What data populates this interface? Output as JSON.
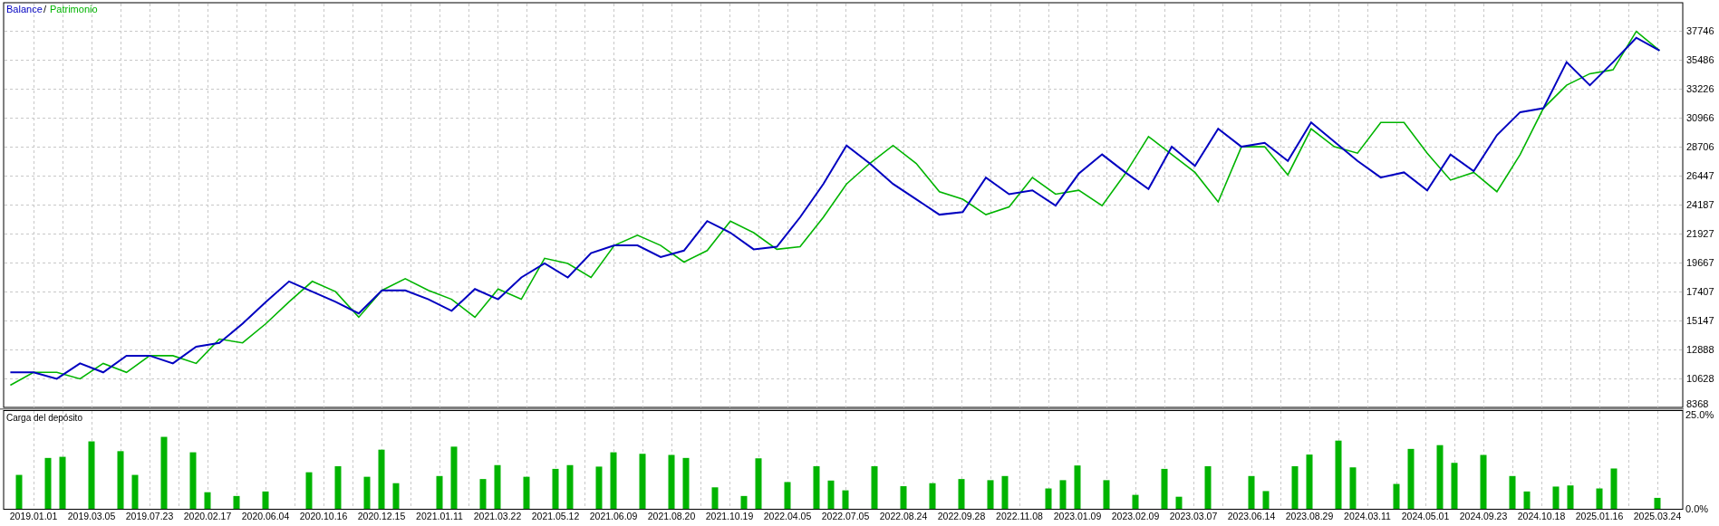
{
  "equity_chart": {
    "legend_separator": "/",
    "chart_data": {
      "type": "line",
      "grid": true,
      "ylim": [
        8368,
        39935
      ],
      "yticks": [
        8368,
        10628,
        12888,
        15147,
        17407,
        19667,
        21927,
        24187,
        26447,
        28706,
        30966,
        33226,
        35486,
        37746
      ],
      "series": [
        {
          "name": "Balance",
          "color": "#0000c0",
          "values": [
            11100,
            11100,
            10600,
            11800,
            11100,
            12400,
            12400,
            11800,
            13100,
            13400,
            14900,
            16600,
            18200,
            17400,
            16600,
            15700,
            17500,
            17500,
            16800,
            15900,
            17600,
            16800,
            18500,
            19600,
            18500,
            20400,
            21000,
            21000,
            20100,
            20600,
            22900,
            22000,
            20700,
            20900,
            23200,
            25800,
            28800,
            27400,
            25800,
            24600,
            23400,
            23600,
            26300,
            25000,
            25300,
            24100,
            26600,
            28100,
            26700,
            25400,
            28700,
            27200,
            30100,
            28700,
            29000,
            27600,
            30600,
            29100,
            27600,
            26300,
            26700,
            25300,
            28100,
            26800,
            29600,
            31400,
            31700,
            35300,
            33500,
            35300,
            37200,
            36200
          ]
        },
        {
          "name": "Patrimonio",
          "color": "#00b400",
          "values": [
            10100,
            11100,
            11100,
            10600,
            11800,
            11100,
            12400,
            12400,
            11800,
            13700,
            13400,
            14900,
            16600,
            18200,
            17400,
            15400,
            17500,
            18400,
            17500,
            16800,
            15400,
            17600,
            16800,
            20000,
            19600,
            18500,
            21000,
            21800,
            21000,
            19700,
            20600,
            22900,
            22000,
            20700,
            20900,
            23200,
            25800,
            27400,
            28800,
            27400,
            25200,
            24600,
            23400,
            24000,
            26300,
            25000,
            25300,
            24100,
            26600,
            29500,
            28100,
            26700,
            24400,
            28700,
            28700,
            26500,
            30100,
            28700,
            28200,
            30600,
            30600,
            28200,
            26100,
            26700,
            25200,
            28100,
            31700,
            33500,
            34400,
            34700,
            37700,
            36200
          ]
        }
      ]
    }
  },
  "deposit_load_chart": {
    "chart_data": {
      "type": "bar",
      "title": "Carga del depósito",
      "grid": true,
      "ylim": [
        0,
        26.2
      ],
      "color": "#00b400",
      "yticks": [
        {
          "value": 0,
          "label": "0.0%"
        },
        {
          "value": 25,
          "label": "25.0%"
        }
      ],
      "categories": [
        null,
        null,
        "2019.01.01",
        null,
        null,
        null,
        "2019.03.05",
        null,
        null,
        null,
        "2019.07.23",
        null,
        null,
        null,
        "2020.02.17",
        null,
        null,
        null,
        "2020.06.04",
        null,
        null,
        null,
        "2020.10.16",
        null,
        null,
        null,
        "2020.12.15",
        null,
        null,
        null,
        "2021.01.11",
        null,
        null,
        null,
        "2021.03.22",
        null,
        null,
        null,
        "2021.05.12",
        null,
        null,
        null,
        "2021.06.09",
        null,
        null,
        null,
        "2021.08.20",
        null,
        null,
        null,
        "2021.10.19",
        null,
        null,
        null,
        "2022.04.05",
        null,
        null,
        null,
        "2022.07.05",
        null,
        null,
        null,
        "2022.08.24",
        null,
        null,
        null,
        "2022.09.28",
        null,
        null,
        null,
        "2022.11.08",
        null,
        null,
        null,
        "2023.01.09",
        null,
        null,
        null,
        "2023.02.09",
        null,
        null,
        null,
        "2023.03.07",
        null,
        null,
        null,
        "2023.06.14",
        null,
        null,
        null,
        "2023.08.29",
        null,
        null,
        null,
        "2024.03.11",
        null,
        null,
        null,
        "2024.05.01",
        null,
        null,
        null,
        "2024.09.23",
        null,
        null,
        null,
        "2024.10.18",
        null,
        null,
        null,
        "2025.01.16",
        null,
        null,
        null,
        "2025.03.24",
        null
      ],
      "values": [
        null,
        9.0,
        null,
        13.5,
        13.8,
        null,
        17.9,
        null,
        15.3,
        9.0,
        null,
        19.1,
        null,
        15.0,
        4.4,
        null,
        3.4,
        null,
        4.6,
        null,
        null,
        9.7,
        null,
        11.3,
        null,
        8.5,
        15.7,
        6.8,
        null,
        null,
        8.7,
        16.5,
        null,
        7.9,
        11.6,
        null,
        8.5,
        null,
        10.6,
        11.6,
        null,
        11.2,
        15.0,
        null,
        14.6,
        null,
        14.3,
        13.5,
        null,
        5.7,
        null,
        3.4,
        13.4,
        null,
        7.1,
        null,
        11.3,
        7.5,
        4.9,
        null,
        11.3,
        null,
        6.0,
        null,
        6.8,
        null,
        7.9,
        null,
        7.6,
        8.7,
        null,
        null,
        5.4,
        7.6,
        11.5,
        null,
        7.6,
        null,
        3.7,
        null,
        10.6,
        3.2,
        null,
        11.3,
        null,
        null,
        8.7,
        4.7,
        null,
        11.3,
        14.4,
        null,
        18.1,
        11.0,
        null,
        null,
        6.6,
        15.9,
        null,
        16.9,
        12.2,
        null,
        14.3,
        null,
        8.7,
        4.6,
        null,
        5.9,
        6.2,
        null,
        5.4,
        10.7,
        null,
        null,
        2.9,
        null
      ]
    }
  }
}
